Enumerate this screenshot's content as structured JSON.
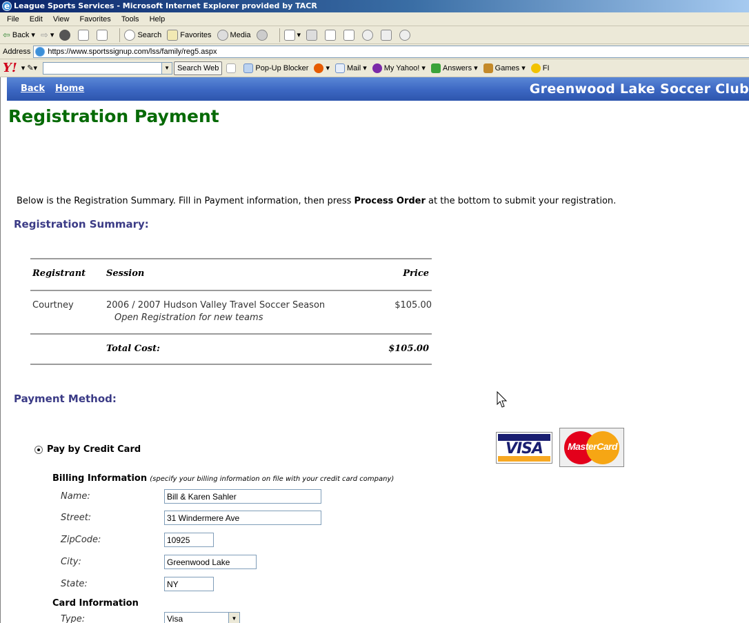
{
  "window": {
    "title": "League Sports Services - Microsoft Internet Explorer provided by TACR"
  },
  "menu": [
    "File",
    "Edit",
    "View",
    "Favorites",
    "Tools",
    "Help"
  ],
  "toolbar": {
    "back": "Back",
    "search": "Search",
    "favorites": "Favorites",
    "media": "Media"
  },
  "address": {
    "label": "Address",
    "url": "https://www.sportssignup.com/lss/family/reg5.aspx"
  },
  "yahoo": {
    "search_btn": "Search Web",
    "popup": "Pop-Up Blocker",
    "mail": "Mail",
    "myyahoo": "My Yahoo!",
    "answers": "Answers",
    "games": "Games",
    "more": "FI"
  },
  "header": {
    "back": "Back",
    "home": "Home",
    "club": "Greenwood Lake Soccer Club"
  },
  "page": {
    "title": "Registration Payment",
    "intro_pre": "Below is the Registration Summary. Fill in Payment information, then press ",
    "intro_bold": "Process Order",
    "intro_post": " at the bottom to submit your registration."
  },
  "summary": {
    "title": "Registration Summary:",
    "headers": {
      "registrant": "Registrant",
      "session": "Session",
      "price": "Price"
    },
    "row": {
      "registrant": "Courtney",
      "session": "2006 / 2007 Hudson Valley Travel Soccer Season",
      "session_sub": "Open Registration for new teams",
      "price": "$105.00"
    },
    "total_label": "Total Cost:",
    "total_value": "$105.00"
  },
  "payment": {
    "title": "Payment Method:",
    "option": "Pay by Credit Card",
    "visa": "VISA",
    "mastercard": "MasterCard",
    "billing_title": "Billing Information",
    "billing_note": "(specify your billing information on file with your credit card company)",
    "labels": {
      "name": "Name:",
      "street": "Street:",
      "zip": "ZipCode:",
      "city": "City:",
      "state": "State:",
      "type": "Type:"
    },
    "values": {
      "name": "Bill & Karen Sahler",
      "street": "31 Windermere Ave",
      "zip": "10925",
      "city": "Greenwood Lake",
      "state": "NY",
      "type": "Visa"
    },
    "card_title": "Card Information"
  }
}
